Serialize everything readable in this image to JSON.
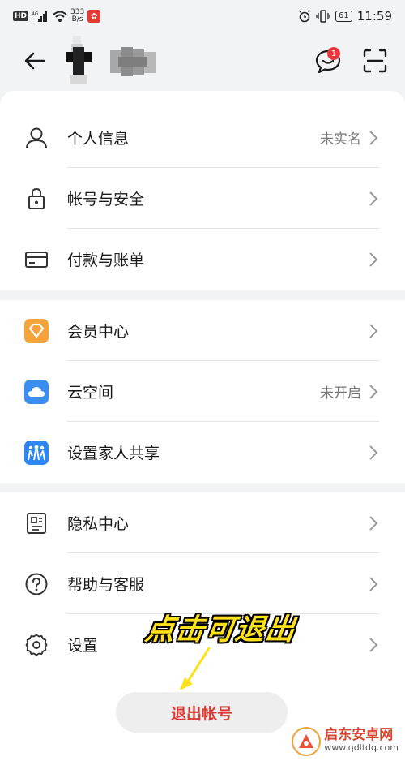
{
  "status_bar": {
    "hd": "HD",
    "net_speed_value": "333",
    "net_speed_unit": "B/s",
    "battery": "61",
    "time": "11:59"
  },
  "header": {
    "message_badge": "1"
  },
  "menu": {
    "group1": [
      {
        "label": "个人信息",
        "value": "未实名",
        "icon": "person-icon"
      },
      {
        "label": "帐号与安全",
        "value": "",
        "icon": "lock-icon"
      },
      {
        "label": "付款与账单",
        "value": "",
        "icon": "card-icon"
      }
    ],
    "group2": [
      {
        "label": "会员中心",
        "value": "",
        "icon": "member-diamond-icon"
      },
      {
        "label": "云空间",
        "value": "未开启",
        "icon": "cloud-icon"
      },
      {
        "label": "设置家人共享",
        "value": "",
        "icon": "family-share-icon"
      }
    ],
    "group3": [
      {
        "label": "隐私中心",
        "value": "",
        "icon": "privacy-icon"
      },
      {
        "label": "帮助与客服",
        "value": "",
        "icon": "help-icon"
      },
      {
        "label": "设置",
        "value": "",
        "icon": "gear-icon"
      }
    ]
  },
  "logout_label": "退出帐号",
  "annotation_text": "点击可退出",
  "watermark": {
    "title": "启东安卓网",
    "url": "www.qdltdq.com"
  },
  "colors": {
    "accent_red": "#d93a35",
    "annotation_yellow": "#ffe11a",
    "background": "#f1f3f5"
  }
}
